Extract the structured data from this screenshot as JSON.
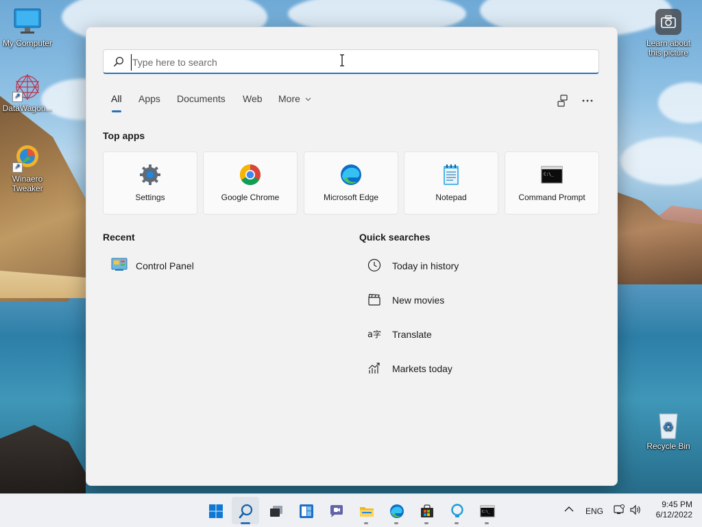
{
  "desktop": {
    "icons": [
      {
        "label": "My Computer"
      },
      {
        "label": "DataWagon..."
      },
      {
        "label": "Winaero Tweaker"
      },
      {
        "label": "Learn about this picture"
      },
      {
        "label": "Recycle Bin"
      }
    ]
  },
  "search": {
    "placeholder": "Type here to search",
    "value": ""
  },
  "tabs": [
    {
      "label": "All",
      "active": true
    },
    {
      "label": "Apps"
    },
    {
      "label": "Documents"
    },
    {
      "label": "Web"
    },
    {
      "label": "More"
    }
  ],
  "toolbar": {
    "share_icon": "share-search-icon",
    "more_icon": "more-options-icon"
  },
  "top_apps": {
    "title": "Top apps",
    "items": [
      {
        "label": "Settings",
        "icon": "settings-gear-icon"
      },
      {
        "label": "Google Chrome",
        "icon": "chrome-icon"
      },
      {
        "label": "Microsoft Edge",
        "icon": "edge-icon"
      },
      {
        "label": "Notepad",
        "icon": "notepad-icon"
      },
      {
        "label": "Command Prompt",
        "icon": "command-prompt-icon"
      }
    ]
  },
  "recent": {
    "title": "Recent",
    "items": [
      {
        "label": "Control Panel",
        "icon": "control-panel-icon"
      }
    ]
  },
  "quick_searches": {
    "title": "Quick searches",
    "items": [
      {
        "label": "Today in history",
        "icon": "clock-icon"
      },
      {
        "label": "New movies",
        "icon": "clapperboard-icon"
      },
      {
        "label": "Translate",
        "icon": "translate-icon"
      },
      {
        "label": "Markets today",
        "icon": "chart-icon"
      }
    ]
  },
  "taskbar": {
    "apps": [
      "start",
      "search",
      "task-view",
      "widgets",
      "chat",
      "file-explorer",
      "edge",
      "store",
      "cortana",
      "terminal"
    ],
    "language": "ENG",
    "time": "9:45 PM",
    "date": "6/12/2022"
  },
  "colors": {
    "accent": "#2a6fb6",
    "panel": "#f2f2f2"
  }
}
